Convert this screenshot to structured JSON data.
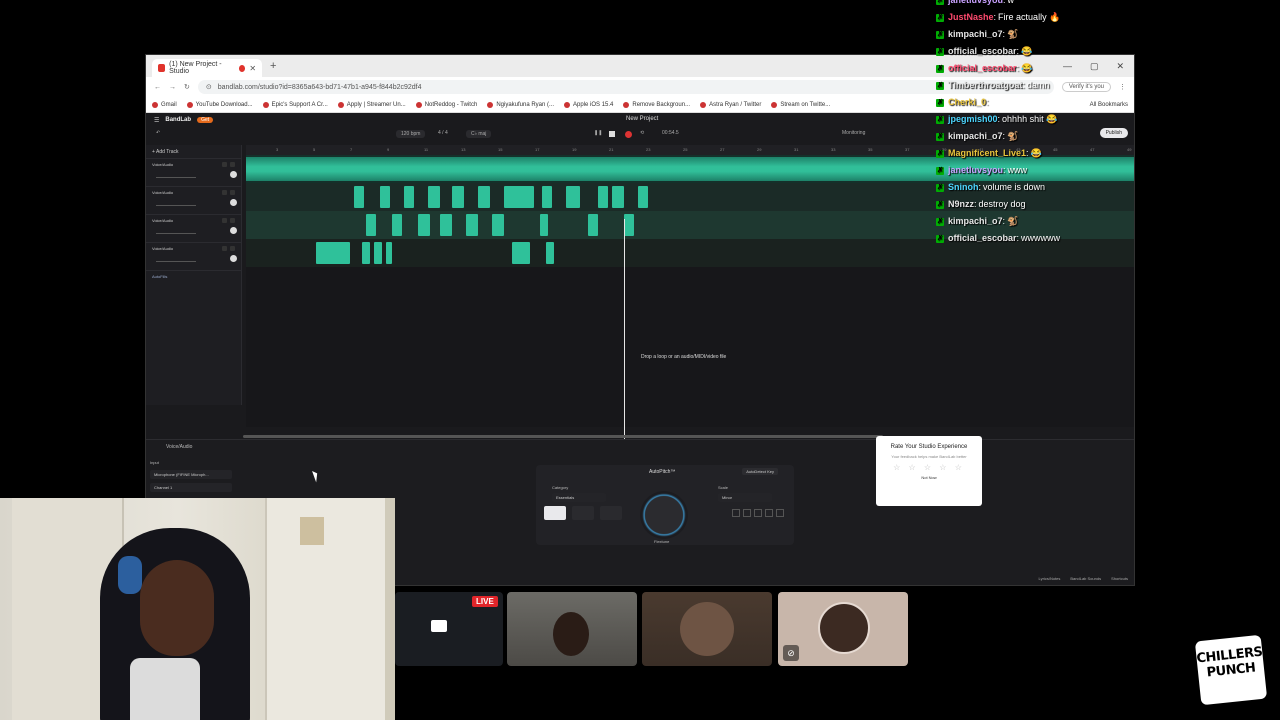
{
  "browser": {
    "tab_title": "(1) New Project - Studio",
    "new_tab": "+",
    "url": "bandlab.com/studio?id=8365a643-bd71-47b1-a945-f844b2c92df4",
    "verify": "Verify it's you",
    "window_controls": [
      "—",
      "▢",
      "✕"
    ],
    "bookmarks": [
      "Gmail",
      "YouTube Download...",
      "Epic's Support A Cr...",
      "Apply | Streamer Un...",
      "NotReddog - Twitch",
      "Ngiyakufuna Ryan (...",
      "Apple iOS 15.4",
      "Remove Backgroun...",
      "Astra Ryan / Twitter",
      "Stream on Twitte..."
    ],
    "all_bookmarks": "All Bookmarks"
  },
  "app": {
    "logo": "BandLab",
    "get": "Get",
    "project_title": "New Project",
    "bpm": "120 bpm",
    "time_sig": "4 / 4",
    "key": "C♭ maj",
    "time": "00:54.5",
    "monitoring": "Monitoring",
    "publish": "Publish",
    "add_track": "+ Add Track",
    "tracks": [
      {
        "name": "Voice/Audio"
      },
      {
        "name": "Voice/Audio"
      },
      {
        "name": "Voice/Audio"
      },
      {
        "name": "Voice/Audio"
      }
    ],
    "autofill": "AutoFills",
    "ruler": [
      "3",
      "5",
      "7",
      "9",
      "11",
      "13",
      "15",
      "17",
      "19",
      "21",
      "23",
      "25",
      "27",
      "29",
      "31",
      "33",
      "35",
      "37",
      "39",
      "41",
      "43",
      "45",
      "47",
      "49"
    ],
    "drop_text": "Drop a loop or an audio/MIDI/video file",
    "bottom": {
      "track_label": "Voice/Audio",
      "input_label": "Input",
      "input_device": "Microphone (FIFINE Microph...",
      "channel": "Channel 1",
      "autopitch_title": "AutoPitch™",
      "autodetect": "AutoDetect Key",
      "category_label": "Category",
      "category_value": "Essentials",
      "scale_label": "Scale",
      "scale_value": "Minor",
      "dial_label": "Flextune",
      "links": [
        "Lyrics/Notes",
        "BandLab Sounds",
        "Shortcuts"
      ]
    },
    "rate": {
      "title": "Rate Your Studio Experience",
      "subtitle": "Your feedback helps make BandLab better",
      "stars": "☆ ☆ ☆ ☆ ☆",
      "not_now": "Not Now"
    }
  },
  "chat": [
    {
      "user": "janetluvsyou",
      "color": "#c9a2ff",
      "text": "w"
    },
    {
      "user": "JustNashe",
      "color": "#ff4a6e",
      "text": "Fire actually 🔥"
    },
    {
      "user": "kimpachi_o7",
      "color": "#e6e6e6",
      "text": "🐒"
    },
    {
      "user": "official_escobar",
      "color": "#e6e6e6",
      "text": "😂"
    },
    {
      "user": "official_escobar",
      "color": "#ff4a6e",
      "text": "😂"
    },
    {
      "user": "Timberthroatgoat",
      "color": "#e6e6e6",
      "text": "damn"
    },
    {
      "user": "Cherki_0",
      "color": "#e9c43c",
      "text": ""
    },
    {
      "user": "jpegmish00",
      "color": "#4dd6ff",
      "text": "ohhhh shit 😂"
    },
    {
      "user": "kimpachi_o7",
      "color": "#e6e6e6",
      "text": "🐒"
    },
    {
      "user": "Magnificent_Live1",
      "color": "#e9c43c",
      "text": "😂"
    },
    {
      "user": "janetluvsyou",
      "color": "#c9a2ff",
      "text": "www"
    },
    {
      "user": "Sninoh",
      "color": "#4dd6ff",
      "text": "volume is down"
    },
    {
      "user": "N9nzz",
      "color": "#e6e6e6",
      "text": "destroy dog"
    },
    {
      "user": "kimpachi_o7",
      "color": "#e6e6e6",
      "text": "🐒"
    },
    {
      "user": "official_escobar",
      "color": "#e6e6e6",
      "text": "wwwwww"
    }
  ],
  "live_badge": "LIVE",
  "brand": "CHILLERS PUNCH"
}
